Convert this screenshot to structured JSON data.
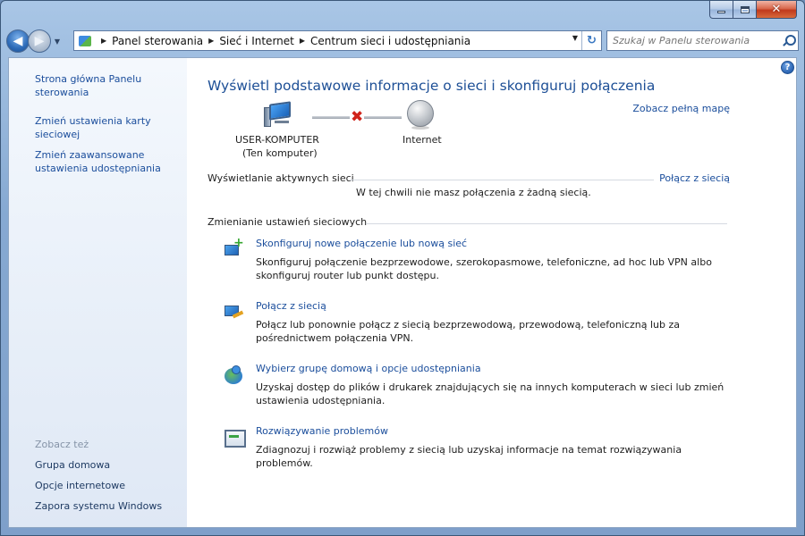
{
  "window": {
    "minimize_glyph": "minimize",
    "maximize_glyph": "maximize",
    "close_glyph": "✕"
  },
  "nav": {
    "back_glyph": "◀",
    "forward_glyph": "▶",
    "recent_glyph": "▼",
    "breadcrumbs": [
      "Panel sterowania",
      "Sieć i Internet",
      "Centrum sieci i udostępniania"
    ],
    "crumb_sep": "▶",
    "address_dropdown_glyph": "▼",
    "refresh_glyph": "↻",
    "search_placeholder": "Szukaj w Panelu sterowania"
  },
  "sidebar": {
    "links": [
      "Strona główna Panelu sterowania",
      "Zmień ustawienia karty sieciowej",
      "Zmień zaawansowane ustawienia udostępniania"
    ],
    "see_also_title": "Zobacz też",
    "see_also": [
      "Grupa domowa",
      "Opcje internetowe",
      "Zapora systemu Windows"
    ]
  },
  "main": {
    "help_glyph": "?",
    "heading": "Wyświetl podstawowe informacje o sieci i skonfiguruj połączenia",
    "full_map_link": "Zobacz pełną mapę",
    "computer_name": "USER-KOMPUTER",
    "computer_sub": "(Ten komputer)",
    "disconnect_glyph": "✖",
    "internet_label": "Internet",
    "active_title": "Wyświetlanie aktywnych sieci",
    "connect_link": "Połącz z siecią",
    "no_connection": "W tej chwili nie masz połączenia z żadną siecią.",
    "change_title": "Zmienianie ustawień sieciowych",
    "tasks": [
      {
        "title": "Skonfiguruj nowe połączenie lub nową sieć",
        "desc": "Skonfiguruj połączenie bezprzewodowe, szerokopasmowe, telefoniczne, ad hoc lub VPN albo skonfiguruj router lub punkt dostępu.",
        "icon": "new-connection-icon"
      },
      {
        "title": "Połącz z siecią",
        "desc": "Połącz lub ponownie połącz z siecią bezprzewodową, przewodową, telefoniczną lub za pośrednictwem połączenia VPN.",
        "icon": "connect-network-icon"
      },
      {
        "title": "Wybierz grupę domową i opcje udostępniania",
        "desc": "Uzyskaj dostęp do plików i drukarek znajdujących się na innych komputerach w sieci lub zmień ustawienia udostępniania.",
        "icon": "homegroup-icon"
      },
      {
        "title": "Rozwiązywanie problemów",
        "desc": "Zdiagnozuj i rozwiąż problemy z siecią lub uzyskaj informacje na temat rozwiązywania problemów.",
        "icon": "troubleshoot-icon"
      }
    ]
  }
}
